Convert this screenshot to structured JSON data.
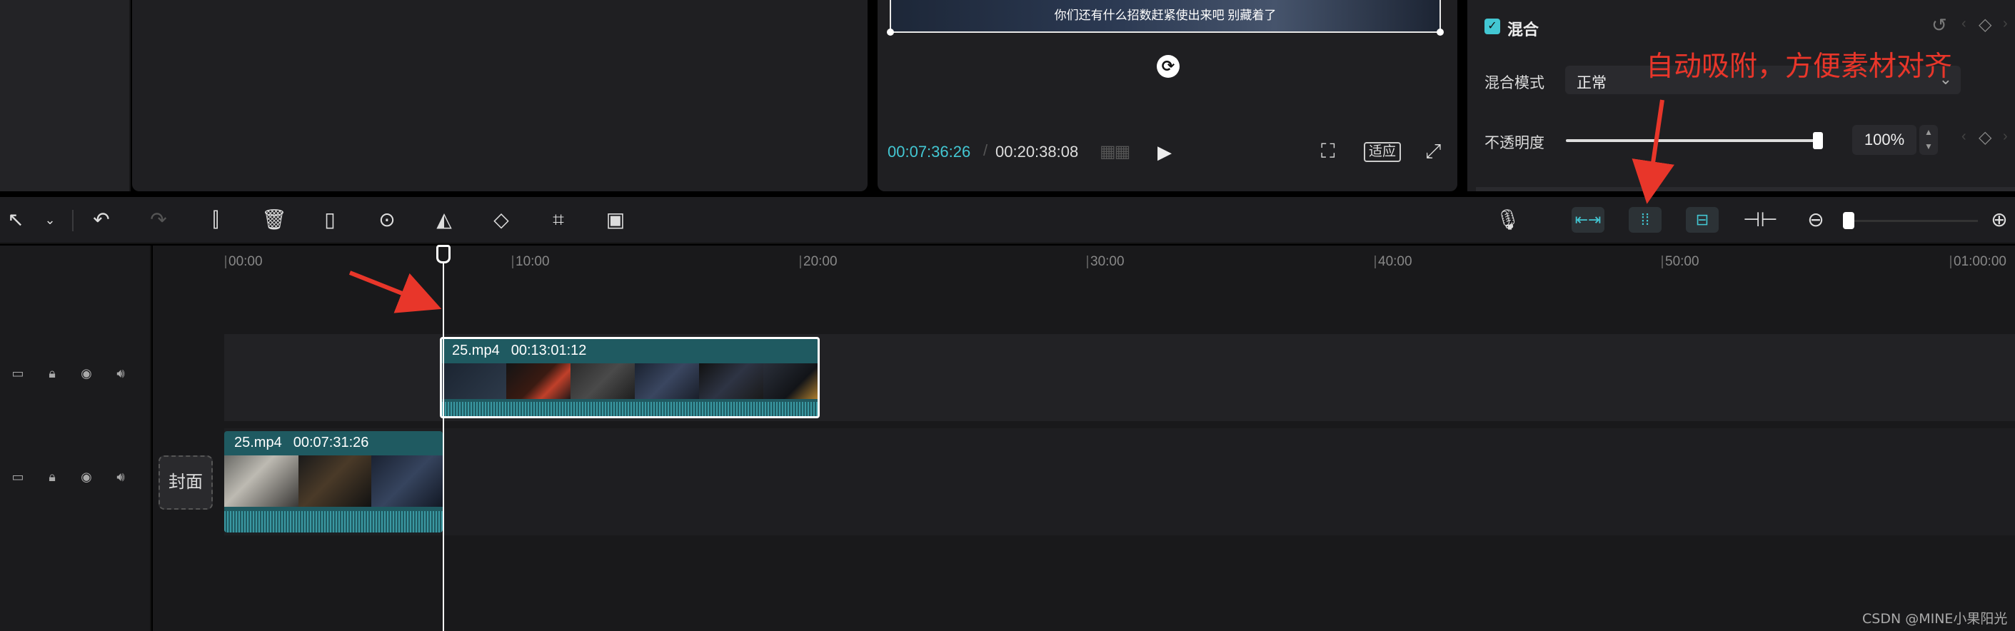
{
  "player": {
    "subtitle": "你们还有什么招数赶紧使出来吧  别藏着了",
    "current_time": "00:07:36:26",
    "separator": "/",
    "total_time": "00:20:38:08",
    "fit_label": "适应"
  },
  "properties": {
    "blend_title": "混合",
    "blend_mode_label": "混合模式",
    "blend_mode_value": "正常",
    "opacity_label": "不透明度",
    "opacity_value": "100%",
    "opacity_level": 1.0
  },
  "annotation": {
    "text": "自动吸附，方便素材对齐"
  },
  "toolbar": {
    "icons": [
      "select-icon",
      "dropdown-icon",
      "undo-icon",
      "redo-icon",
      "split-icon",
      "delete-icon",
      "freeze-frame-icon",
      "reverse-icon",
      "mirror-icon",
      "rotate-icon",
      "crop-icon",
      "smart-crop-icon",
      "microphone-icon",
      "link-main-track-icon",
      "auto-snap-icon",
      "link-preview-icon",
      "split-align-icon",
      "zoom-out-icon",
      "zoom-in-icon"
    ]
  },
  "timeline": {
    "ruler": [
      "00:00",
      "10:00",
      "20:00",
      "30:00",
      "40:00",
      "50:00",
      "01:00:00"
    ],
    "cover_label": "封面",
    "clips": [
      {
        "name": "25.mp4",
        "duration": "00:13:01:12"
      },
      {
        "name": "25.mp4",
        "duration": "00:07:31:26"
      }
    ]
  },
  "watermark": "CSDN @MINE小果阳光",
  "colors": {
    "accent": "#43c7d3",
    "annotation": "#e8362a",
    "clip": "#1f5a61"
  }
}
